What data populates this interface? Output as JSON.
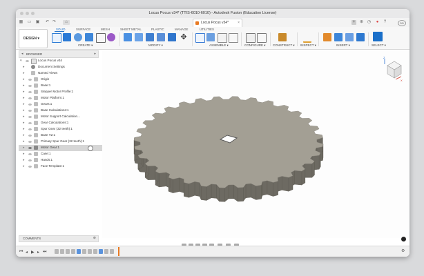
{
  "window": {
    "title": "Locus Pocus v34* (TTIS-6010-6010) - Autodesk Fusion (Education License)"
  },
  "doc_tab": {
    "label": "Locus Pocus v34*"
  },
  "ribbon": {
    "workspace": "DESIGN ▾",
    "tabs": [
      "SOLID",
      "SURFACE",
      "MESH",
      "SHEET METAL",
      "PLASTIC",
      "MANAGE",
      "UTILITIES"
    ],
    "groups": [
      "CREATE ▾",
      "MODIFY ▾",
      "ASSEMBLE ▾",
      "CONFIGURE ▾",
      "CONSTRUCT ▾",
      "INSPECT ▾",
      "INSERT ▾",
      "SELECT ▾"
    ]
  },
  "browser": {
    "title": "BROWSER",
    "items": [
      {
        "label": "Locus Pocus v34",
        "level": 0
      },
      {
        "label": "Document Settings",
        "level": 1
      },
      {
        "label": "Named Views",
        "level": 1
      },
      {
        "label": "Origin",
        "level": 1
      },
      {
        "label": "Base:1",
        "level": 1
      },
      {
        "label": "Stepper Motor Profile:1",
        "level": 1
      },
      {
        "label": "Motor Platform:1",
        "level": 1
      },
      {
        "label": "Gears:1",
        "level": 1
      },
      {
        "label": "Base Calculations:1",
        "level": 1
      },
      {
        "label": "Motor Support Calculation...",
        "level": 1
      },
      {
        "label": "Gear Calculations:1",
        "level": 1
      },
      {
        "label": "Spur Gear (32 teeth):1",
        "level": 1
      },
      {
        "label": "Base V2:1",
        "level": 1
      },
      {
        "label": "Primary Spur Gear (32 teeth):1",
        "level": 1
      },
      {
        "label": "Motor Gear:1",
        "level": 1
      },
      {
        "label": "Case:1",
        "level": 1
      },
      {
        "label": "Hands:1",
        "level": 1
      },
      {
        "label": "Face Template:1",
        "level": 1
      }
    ]
  },
  "comments": {
    "title": "COMMENTS"
  },
  "viewcube": {
    "face": "FRONT",
    "axes": [
      "Z",
      "X"
    ]
  },
  "colors": {
    "accent": "#1a6fc9",
    "gear_top": "#a39f94",
    "gear_side": "#6d6a62",
    "marker": "#e87a23"
  }
}
